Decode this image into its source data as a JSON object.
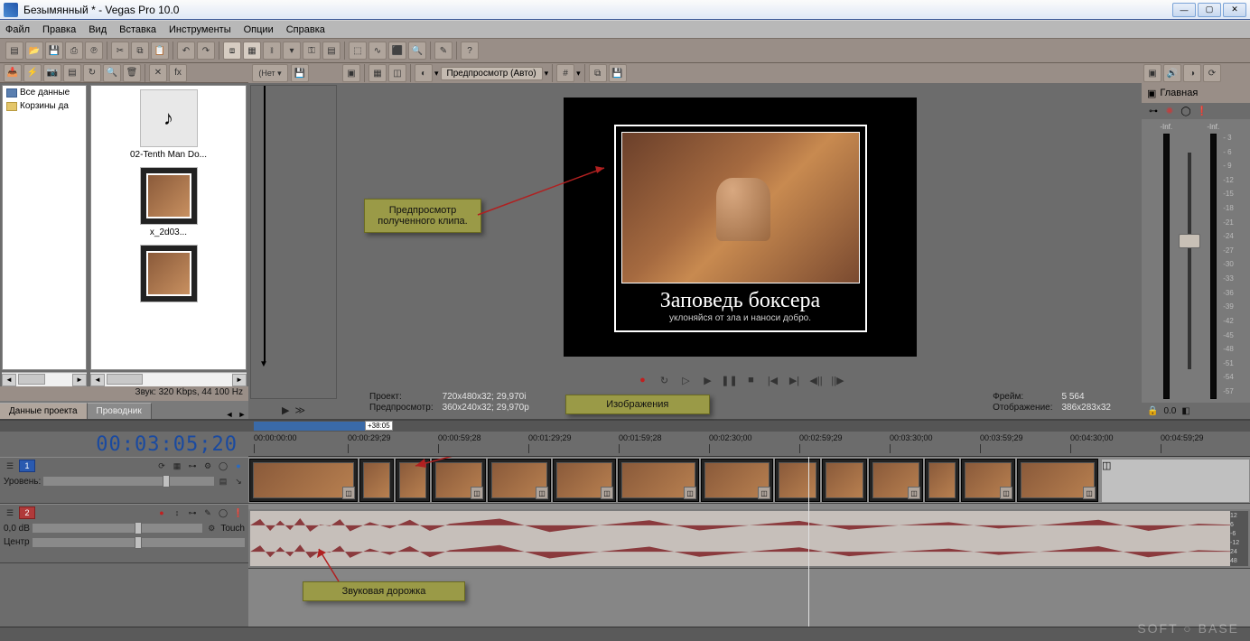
{
  "window": {
    "title": "Безымянный * - Vegas Pro 10.0"
  },
  "menu": [
    "Файл",
    "Правка",
    "Вид",
    "Вставка",
    "Инструменты",
    "Опции",
    "Справка"
  ],
  "left": {
    "tree": [
      {
        "icon": "film",
        "label": "Все данные"
      },
      {
        "icon": "folder",
        "label": "Корзины да"
      }
    ],
    "media": [
      {
        "kind": "audio",
        "label": "02-Tenth Man Do..."
      },
      {
        "kind": "image",
        "label": "x_2d03..."
      },
      {
        "kind": "image",
        "label": ""
      }
    ],
    "status": "Звук: 320 Kbps, 44 100 Hz",
    "tabs": [
      "Данные проекта",
      "Проводник"
    ],
    "active_tab": 0
  },
  "preview": {
    "combo": "Предпросмотр (Авто)",
    "demotivator_title": "Заповедь боксера",
    "demotivator_sub": "уклоняйся от зла и наноси добро.",
    "info": {
      "project_lbl": "Проект:",
      "project_val": "720x480x32; 29,970i",
      "preview_lbl": "Предпросмотр:",
      "preview_val": "360x240x32; 29,970p",
      "frame_lbl": "Фрейм:",
      "frame_val": "5 564",
      "display_lbl": "Отображение:",
      "display_val": "386x283x32"
    }
  },
  "mixer": {
    "title": "Главная",
    "inf": "-Inf.",
    "scale": [
      "- 3",
      "- 6",
      "- 9",
      "-12",
      "-15",
      "-18",
      "-21",
      "-24",
      "-27",
      "-30",
      "-33",
      "-36",
      "-39",
      "-42",
      "-45",
      "-48",
      "-51",
      "-54",
      "-57"
    ],
    "foot_val": "0.0"
  },
  "annot": {
    "preview": "Предпросмотр полученного клипа.",
    "images": "Изображения",
    "audio": "Звуковая дорожка"
  },
  "timeline": {
    "timecode": "00:03:05;20",
    "zoom_tag": "+38:05",
    "ruler": [
      "00:00:00:00",
      "00:00:29;29",
      "00:00:59;28",
      "00:01:29;29",
      "00:01:59;28",
      "00:02:30;00",
      "00:02:59;29",
      "00:03:30;00",
      "00:03:59;29",
      "00:04:30;00",
      "00:04:59;29"
    ],
    "video_header": {
      "num": "1"
    },
    "audio_header": {
      "num": "2",
      "db": "0,0 dB",
      "touch": "Touch",
      "center": "Центр"
    },
    "audio_scale": [
      "12",
      "6",
      "-6",
      "-12",
      "24",
      "48"
    ]
  },
  "watermark": "SOFT ○ BASE"
}
